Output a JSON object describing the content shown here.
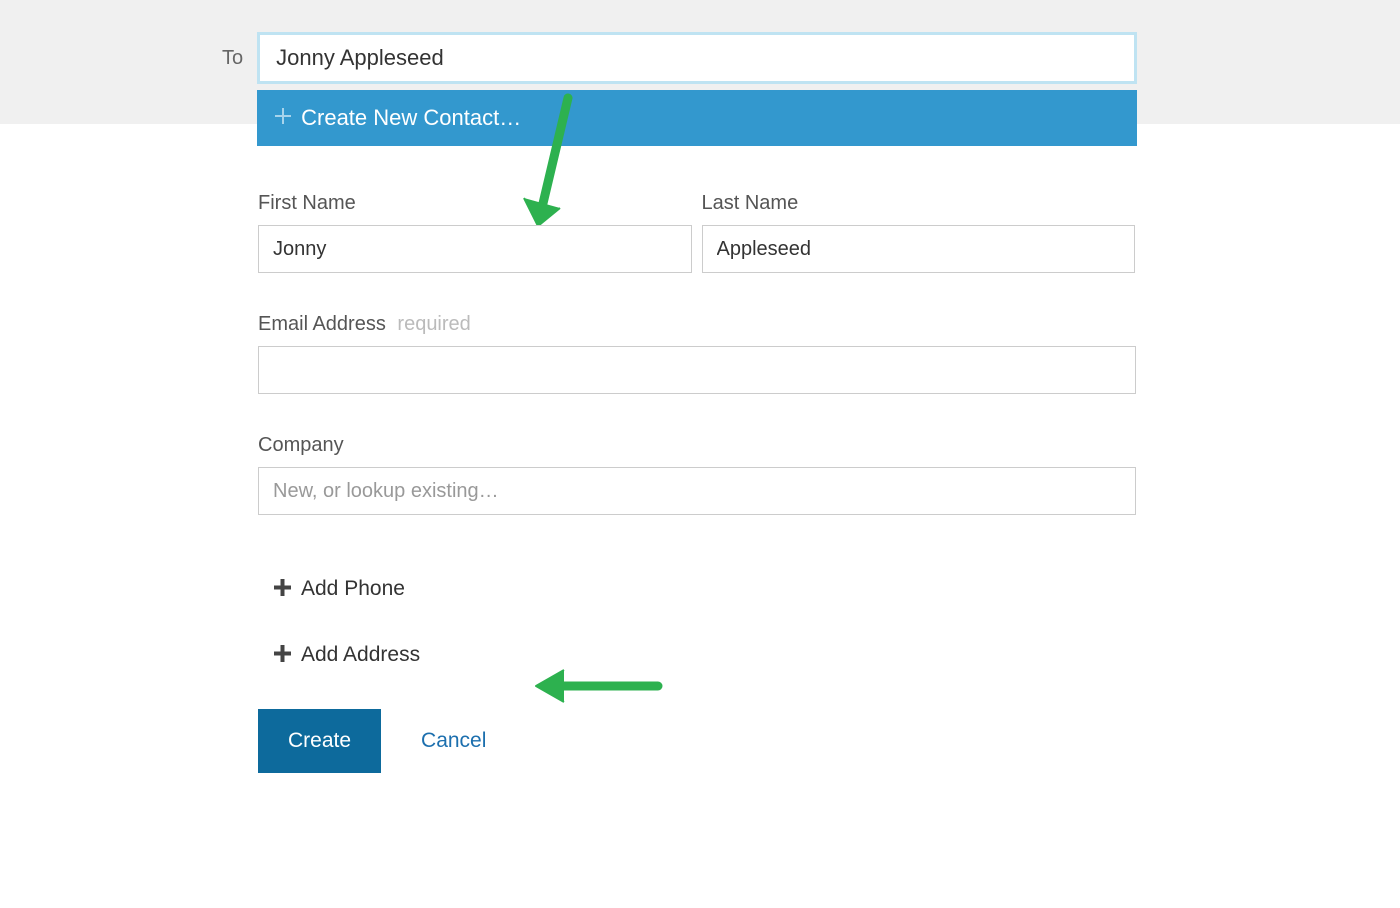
{
  "top": {
    "to_label": "To",
    "to_value": "Jonny Appleseed",
    "dropdown": {
      "label": "Create New Contact…"
    }
  },
  "form": {
    "first_name": {
      "label": "First Name",
      "value": "Jonny"
    },
    "last_name": {
      "label": "Last Name",
      "value": "Appleseed"
    },
    "email": {
      "label": "Email Address",
      "required_hint": "required",
      "value": ""
    },
    "company": {
      "label": "Company",
      "placeholder": "New, or lookup existing…",
      "value": ""
    },
    "add_phone": "Add Phone",
    "add_address": "Add Address",
    "create_button": "Create",
    "cancel_link": "Cancel"
  },
  "colors": {
    "dropdown_bg": "#3398ce",
    "input_focus_border": "#bfe3f2",
    "create_bg": "#0d6a9c",
    "link_blue": "#1c6fae",
    "arrow_green": "#2db14f"
  }
}
